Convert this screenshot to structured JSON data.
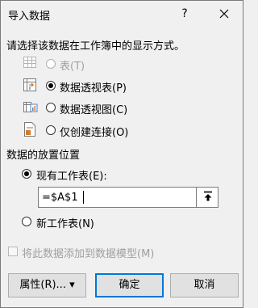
{
  "window": {
    "title": "导入数据",
    "help_symbol": "?"
  },
  "display_section": {
    "heading": "请选择该数据在工作簿中的显示方式。",
    "options": [
      {
        "label": "表(T)",
        "icon": "table-icon",
        "selected": false,
        "enabled": false
      },
      {
        "label": "数据透视表(P)",
        "icon": "pivot-table-icon",
        "selected": true,
        "enabled": true
      },
      {
        "label": "数据透视图(C)",
        "icon": "pivot-chart-icon",
        "selected": false,
        "enabled": true
      },
      {
        "label": "仅创建连接(O)",
        "icon": "connection-only-icon",
        "selected": false,
        "enabled": true
      }
    ]
  },
  "placement_section": {
    "heading": "数据的放置位置",
    "existing_label": "现有工作表(E):",
    "existing_selected": true,
    "range_value": "=$A$1",
    "new_label": "新工作表(N)",
    "new_selected": false
  },
  "data_model": {
    "label": "将此数据添加到数据模型(M)",
    "checked": false,
    "enabled": false
  },
  "buttons": {
    "properties": "属性(R)...",
    "properties_arrow": "▾",
    "ok": "确定",
    "cancel": "取消"
  },
  "colors": {
    "accent": "#0078d7",
    "disabled_text": "#a0a0a0",
    "pivot_icon_orange": "#d67a2e",
    "icon_blue": "#4a86c8"
  }
}
